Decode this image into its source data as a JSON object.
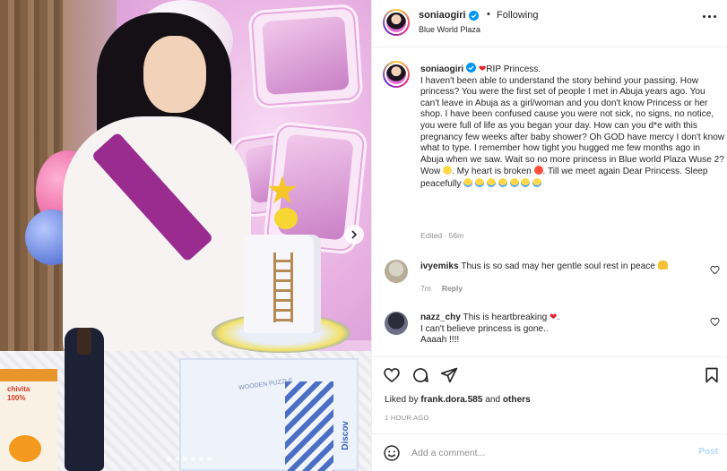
{
  "post": {
    "username": "soniaogiri",
    "follow_separator": "•",
    "follow_label": "Following",
    "location": "Blue World Plaza",
    "media": {
      "carousel_dots": 6,
      "active_dot": 0,
      "carton_label": "chivita 100%",
      "box_text": "WOODEN PUZZLE",
      "box_side_text": "Discov"
    }
  },
  "caption": {
    "username": "soniaogiri",
    "lines": [
      "RIP Princess.",
      "I haven't been able to understand the story behind your passing. How princess? You were the first set of people I met in Abuja years ago. You can't leave in Abuja as a girl/woman and you don't know Princess or her shop. I have been confused cause you were not sick, no signs, no notice, you were full of life as you began your day. How can you d*e with this pregnancy few weeks after baby shower? Oh GOD have mercy I don't know what to type. I remember how tight you hugged me few months ago in Abuja when we saw. Wait so no more princess in Blue world Plaza Wuse 2? Wow",
      ". My heart is broken",
      ". Till we meet again Dear Princess. Sleep peacefully"
    ],
    "edited": "Edited · 56m"
  },
  "comments": [
    {
      "username": "ivyemiks",
      "text": "Thus is so sad may her gentle soul rest in peace",
      "time": "7m",
      "reply_label": "Reply"
    },
    {
      "username": "nazz_chy",
      "text_line1": "This is heartbreaking",
      "text_line2": "I can't believe princess is gone..",
      "text_line3": "Aaaah !!!!"
    }
  ],
  "actions": {
    "icons": [
      "heart-icon",
      "comment-icon",
      "share-icon",
      "bookmark-icon"
    ]
  },
  "likes": {
    "prefix": "Liked by ",
    "user": "frank.dora.585",
    "suffix": " and ",
    "others": "others"
  },
  "timestamp": "1 HOUR AGO",
  "add_comment": {
    "placeholder": "Add a comment...",
    "post_label": "Post"
  },
  "colors": {
    "verified": "#0095f6",
    "heart": "#e0202b",
    "post_disabled": "#b3dbff"
  }
}
